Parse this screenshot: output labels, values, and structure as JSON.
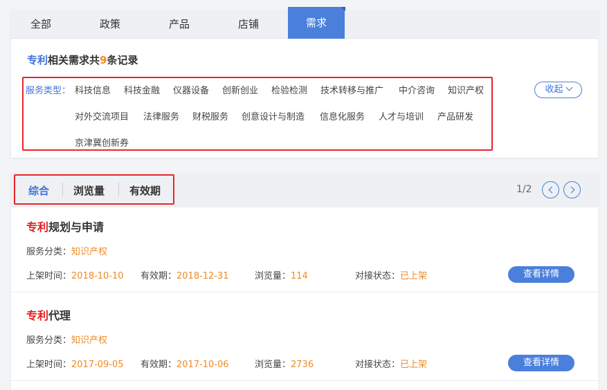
{
  "tabs": [
    "全部",
    "政策",
    "产品",
    "店铺",
    "需求"
  ],
  "active_tab": 4,
  "summary": {
    "keyword": "专利",
    "text_before_count": "相关需求共",
    "count": "9",
    "text_after_count": "条记录"
  },
  "filter": {
    "label": "服务类型：",
    "options": [
      "科技信息",
      "科技金融",
      "仪器设备",
      "创新创业",
      "检验检测",
      "技术转移与推广",
      "中介咨询",
      "知识产权",
      "对外交流项目",
      "法律服务",
      "财税服务",
      "创意设计与制造",
      "信息化服务",
      "人才与培训",
      "产品研发",
      "京津冀创新券"
    ],
    "collapse_label": "收起"
  },
  "sort": {
    "options": [
      "综合",
      "浏览量",
      "有效期"
    ],
    "active": 0
  },
  "pager": {
    "text": "1/2"
  },
  "labels": {
    "category": "服务分类：",
    "listed_time": "上架时间：",
    "valid_until": "有效期：",
    "views": "浏览量：",
    "status": "对接状态：",
    "detail_button": "查看详情"
  },
  "items": [
    {
      "title_keyword": "专利",
      "title_rest": "规划与申请",
      "category": "知识产权",
      "listed_time": "2018-10-10",
      "valid_until": "2018-12-31",
      "views": "114",
      "status": "已上架"
    },
    {
      "title_keyword": "专利",
      "title_rest": "代理",
      "category": "知识产权",
      "listed_time": "2017-09-05",
      "valid_until": "2017-10-06",
      "views": "2736",
      "status": "已上架"
    }
  ],
  "colors": {
    "accent": "#4a7fdc",
    "highlight_orange": "#f08a24",
    "keyword_red": "#e0201f",
    "annotation_red": "#e8252a"
  }
}
